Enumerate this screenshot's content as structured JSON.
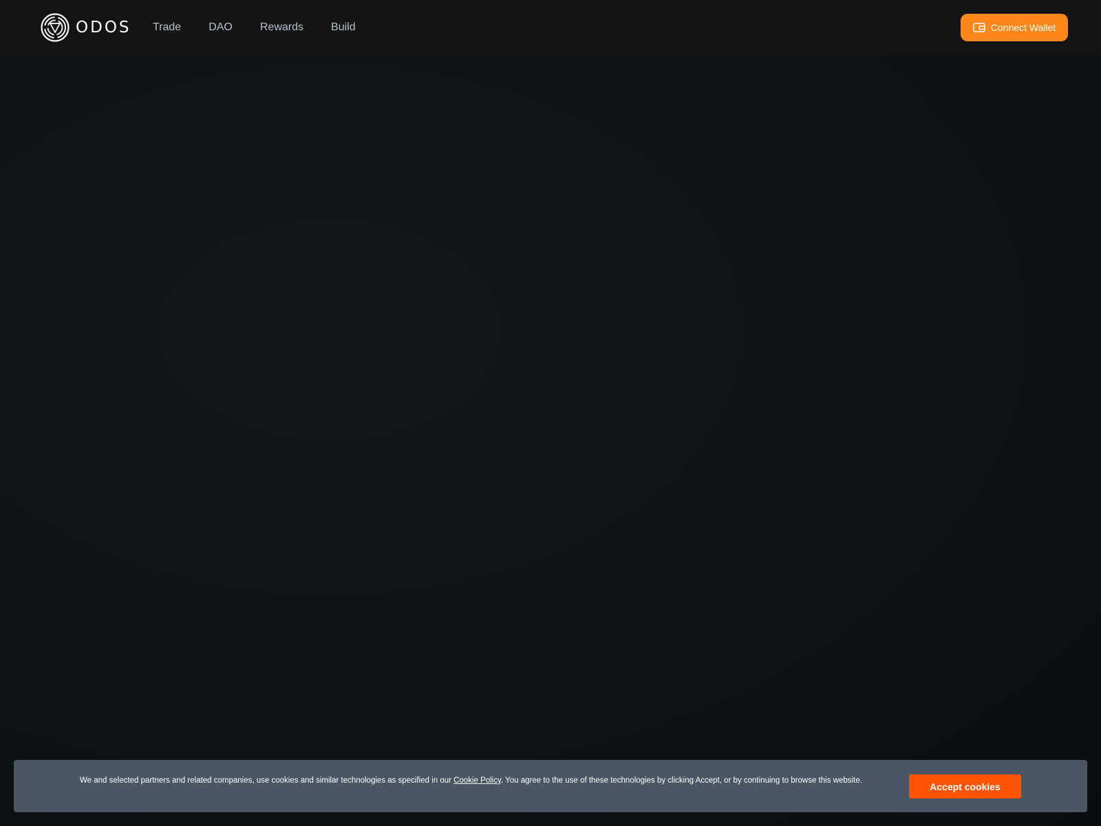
{
  "header": {
    "brand": "ODOS",
    "nav": [
      {
        "label": "Trade"
      },
      {
        "label": "DAO"
      },
      {
        "label": "Rewards"
      },
      {
        "label": "Build"
      }
    ],
    "connect_wallet_label": "Connect Wallet"
  },
  "cookie_banner": {
    "text_before": "We and selected partners and related companies, use cookies and similar technologies as specified in our ",
    "link_text": "Cookie Policy",
    "text_after": ". You agree to the use of these technologies by clicking Accept, or by continuing to browse this website.",
    "accept_label": "Accept cookies"
  },
  "colors": {
    "accent": "#ff861a",
    "accept_button": "#ff5404",
    "header_bg": "#141414",
    "banner_bg": "#4b5563"
  },
  "icons": {
    "logo": "odos-logo-icon",
    "wallet": "wallet-icon"
  }
}
